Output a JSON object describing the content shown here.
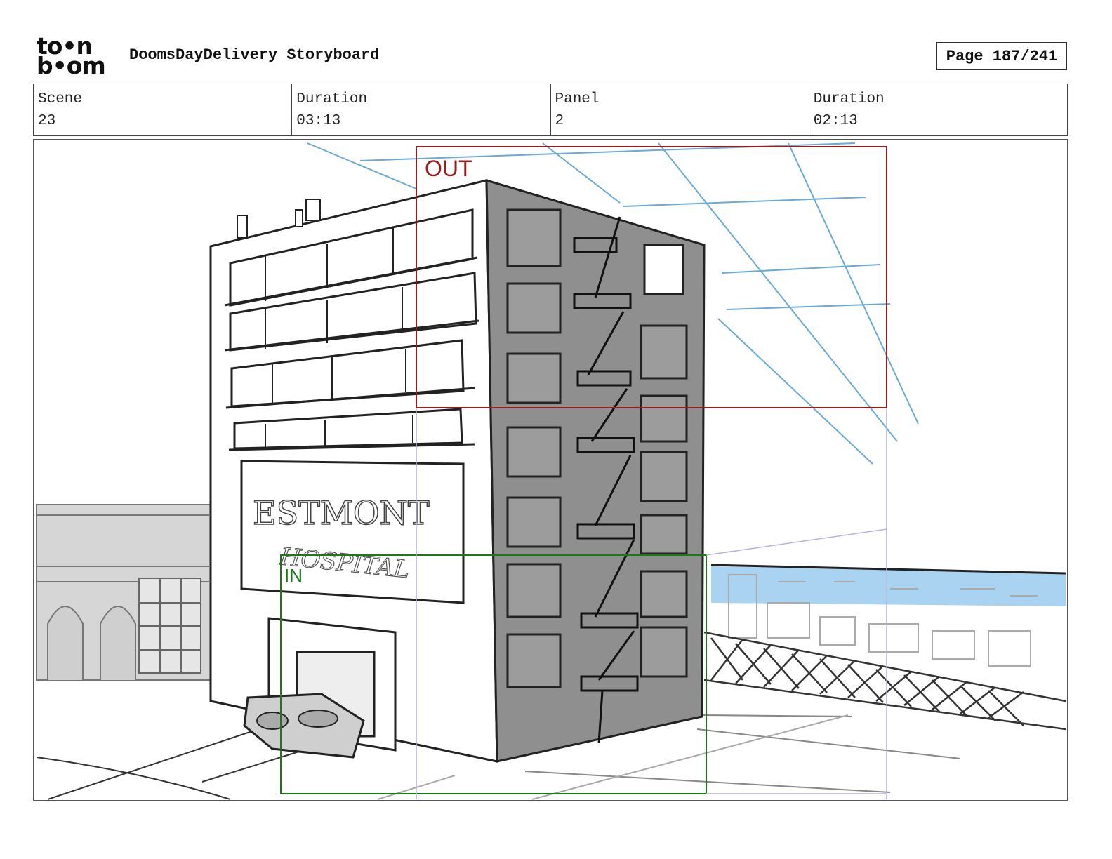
{
  "header": {
    "logo_line1": "to•n",
    "logo_line2": "b•om",
    "title": "DoomsDayDelivery Storyboard",
    "page": "Page 187/241"
  },
  "info": {
    "scene_label": "Scene",
    "scene_value": "23",
    "scene_duration_label": "Duration",
    "scene_duration_value": "03:13",
    "panel_label": "Panel",
    "panel_value": "2",
    "panel_duration_label": "Duration",
    "panel_duration_value": "02:13"
  },
  "panel_image": {
    "frame_out_label": "OUT",
    "frame_in_label": "IN",
    "sign_text_main": "ESTMONT",
    "sign_text_sub": "HOSPITAL",
    "colors": {
      "out_frame": "#9c1c1c",
      "in_frame": "#1a7a1a",
      "guide": "#6aaad6",
      "building_side": "#8f8f8f",
      "water": "#a9d3f0"
    }
  }
}
